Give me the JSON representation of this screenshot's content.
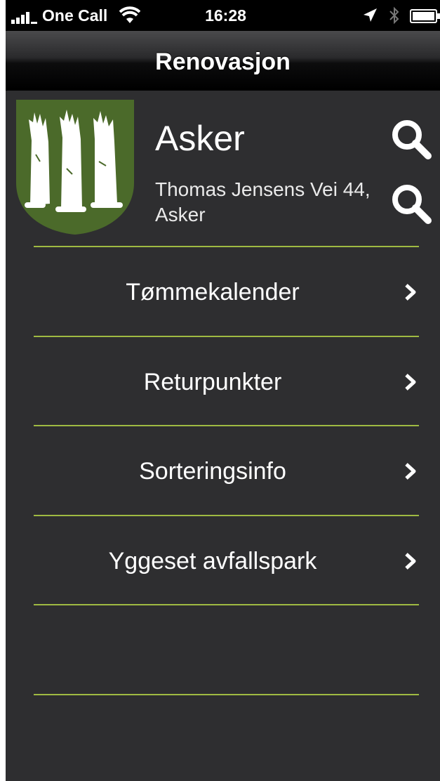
{
  "status_bar": {
    "carrier": "One Call",
    "time": "16:28"
  },
  "nav": {
    "title": "Renovasjon"
  },
  "header": {
    "municipality": "Asker",
    "address": "Thomas Jensens Vei 44, Asker",
    "crest_color": "#4b6a2a"
  },
  "menu": {
    "items": [
      {
        "label": "Tømmekalender"
      },
      {
        "label": "Returpunkter"
      },
      {
        "label": "Sorteringsinfo"
      },
      {
        "label": "Yggeset avfallspark"
      },
      {
        "label": ""
      }
    ]
  },
  "colors": {
    "background": "#2e2e30",
    "divider": "#9fba42",
    "text": "#ffffff"
  },
  "icons": {
    "search": "search-icon",
    "chevron": "chevron-right-icon"
  }
}
